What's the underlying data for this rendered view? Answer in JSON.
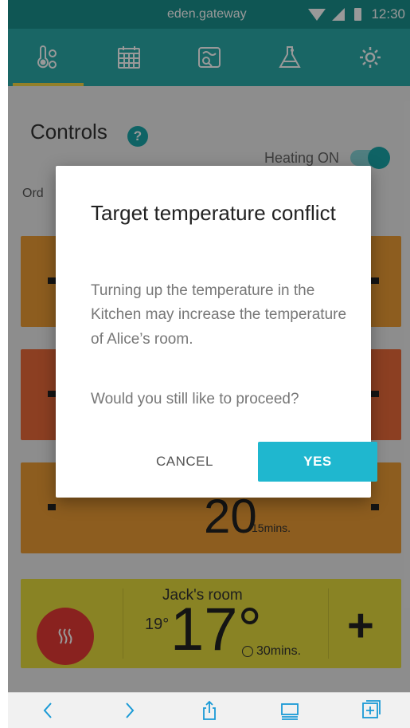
{
  "status_bar": {
    "url": "eden.gateway",
    "time": "12:30"
  },
  "nav": {
    "tabs": [
      {
        "icon": "thermometer-icon"
      },
      {
        "icon": "calendar-icon"
      },
      {
        "icon": "map-icon"
      },
      {
        "icon": "flask-icon"
      },
      {
        "icon": "gear-icon"
      }
    ],
    "active_index": 0
  },
  "page": {
    "title": "Controls",
    "help": "?",
    "heating_label": "Heating ON",
    "order_label": "Ord",
    "cards": [
      {
        "color": "#eb9c35"
      },
      {
        "color": "#ea6a3a"
      },
      {
        "color": "#eb9c35",
        "ghost_temp": "20",
        "ghost_timer": "15mins."
      }
    ],
    "jack_room": {
      "name": "Jack's room",
      "previous_temp": "19°",
      "target_temp": "17°",
      "timer": "30mins.",
      "plus": "+"
    }
  },
  "dialog": {
    "title": "Target temperature conflict",
    "body": "Turning up the temperature in the Kitchen may increase the temperature of Alice’s room.",
    "question": "Would you still like to proceed?",
    "cancel_label": "CANCEL",
    "yes_label": "YES"
  },
  "bottom_bar": {
    "buttons": [
      "back-icon",
      "forward-icon",
      "share-icon",
      "tabs-icon",
      "new-tab-icon"
    ]
  },
  "colors": {
    "status_bar": "#1a8f8c",
    "nav": "#2aaba9",
    "accent": "#1fb7cf",
    "heat_button": "#e53935",
    "jack_card": "#e4db3c"
  }
}
